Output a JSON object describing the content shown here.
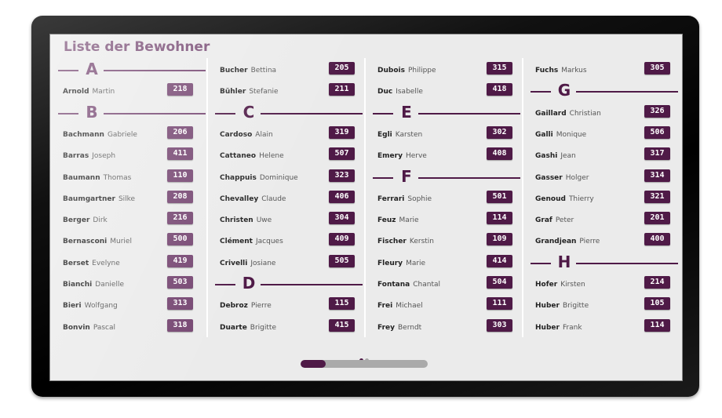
{
  "title": "Liste der Bewohner",
  "colors": {
    "light": "#744470",
    "dark": "#4f1a47",
    "track": "#aaaaaa",
    "dot_inactive": "#aaaaaa"
  },
  "pagination": {
    "pages": 2,
    "current": 1,
    "progress_percent": 20
  },
  "columns": [
    {
      "accent": "light",
      "items": [
        {
          "header": "A"
        },
        {
          "last": "Arnold",
          "first": "Martin",
          "room": "218"
        },
        {
          "header": "B"
        },
        {
          "last": "Bachmann",
          "first": "Gabriele",
          "room": "206"
        },
        {
          "last": "Barras",
          "first": "Joseph",
          "room": "411"
        },
        {
          "last": "Baumann",
          "first": "Thomas",
          "room": "110"
        },
        {
          "last": "Baumgartner",
          "first": "Silke",
          "room": "208"
        },
        {
          "last": "Berger",
          "first": "Dirk",
          "room": "216"
        },
        {
          "last": "Bernasconi",
          "first": "Muriel",
          "room": "500"
        },
        {
          "last": "Berset",
          "first": "Evelyne",
          "room": "419"
        },
        {
          "last": "Bianchi",
          "first": "Danielle",
          "room": "503"
        },
        {
          "last": "Bieri",
          "first": "Wolfgang",
          "room": "313"
        },
        {
          "last": "Bonvin",
          "first": "Pascal",
          "room": "318"
        }
      ]
    },
    {
      "accent": "dark",
      "items": [
        {
          "last": "Bucher",
          "first": "Bettina",
          "room": "205"
        },
        {
          "last": "Bühler",
          "first": "Stefanie",
          "room": "211"
        },
        {
          "header": "C"
        },
        {
          "last": "Cardoso",
          "first": "Alain",
          "room": "319"
        },
        {
          "last": "Cattaneo",
          "first": "Helene",
          "room": "507"
        },
        {
          "last": "Chappuis",
          "first": "Dominique",
          "room": "323"
        },
        {
          "last": "Chevalley",
          "first": "Claude",
          "room": "406"
        },
        {
          "last": "Christen",
          "first": "Uwe",
          "room": "304"
        },
        {
          "last": "Clément",
          "first": "Jacques",
          "room": "409"
        },
        {
          "last": "Crivelli",
          "first": "Josiane",
          "room": "505"
        },
        {
          "header": "D"
        },
        {
          "last": "Debroz",
          "first": "Pierre",
          "room": "115"
        },
        {
          "last": "Duarte",
          "first": "Brigitte",
          "room": "415"
        }
      ]
    },
    {
      "accent": "dark",
      "items": [
        {
          "last": "Dubois",
          "first": "Philippe",
          "room": "315"
        },
        {
          "last": "Duc",
          "first": "Isabelle",
          "room": "418"
        },
        {
          "header": "E"
        },
        {
          "last": "Egli",
          "first": "Karsten",
          "room": "302"
        },
        {
          "last": "Emery",
          "first": "Herve",
          "room": "408"
        },
        {
          "header": "F"
        },
        {
          "last": "Ferrari",
          "first": "Sophie",
          "room": "501"
        },
        {
          "last": "Feuz",
          "first": "Marie",
          "room": "114"
        },
        {
          "last": "Fischer",
          "first": "Kerstin",
          "room": "109"
        },
        {
          "last": "Fleury",
          "first": "Marie",
          "room": "414"
        },
        {
          "last": "Fontana",
          "first": "Chantal",
          "room": "504"
        },
        {
          "last": "Frei",
          "first": "Michael",
          "room": "111"
        },
        {
          "last": "Frey",
          "first": "Berndt",
          "room": "303"
        }
      ]
    },
    {
      "accent": "dark",
      "items": [
        {
          "last": "Fuchs",
          "first": "Markus",
          "room": "305"
        },
        {
          "header": "G"
        },
        {
          "last": "Gaillard",
          "first": "Christian",
          "room": "326"
        },
        {
          "last": "Galli",
          "first": "Monique",
          "room": "506"
        },
        {
          "last": "Gashi",
          "first": "Jean",
          "room": "317"
        },
        {
          "last": "Gasser",
          "first": "Holger",
          "room": "314"
        },
        {
          "last": "Genoud",
          "first": "Thierry",
          "room": "321"
        },
        {
          "last": "Graf",
          "first": "Peter",
          "room": "201"
        },
        {
          "last": "Grandjean",
          "first": "Pierre",
          "room": "400"
        },
        {
          "header": "H"
        },
        {
          "last": "Hofer",
          "first": "Kirsten",
          "room": "214"
        },
        {
          "last": "Huber",
          "first": "Brigitte",
          "room": "105"
        },
        {
          "last": "Huber",
          "first": "Frank",
          "room": "114"
        }
      ]
    }
  ]
}
